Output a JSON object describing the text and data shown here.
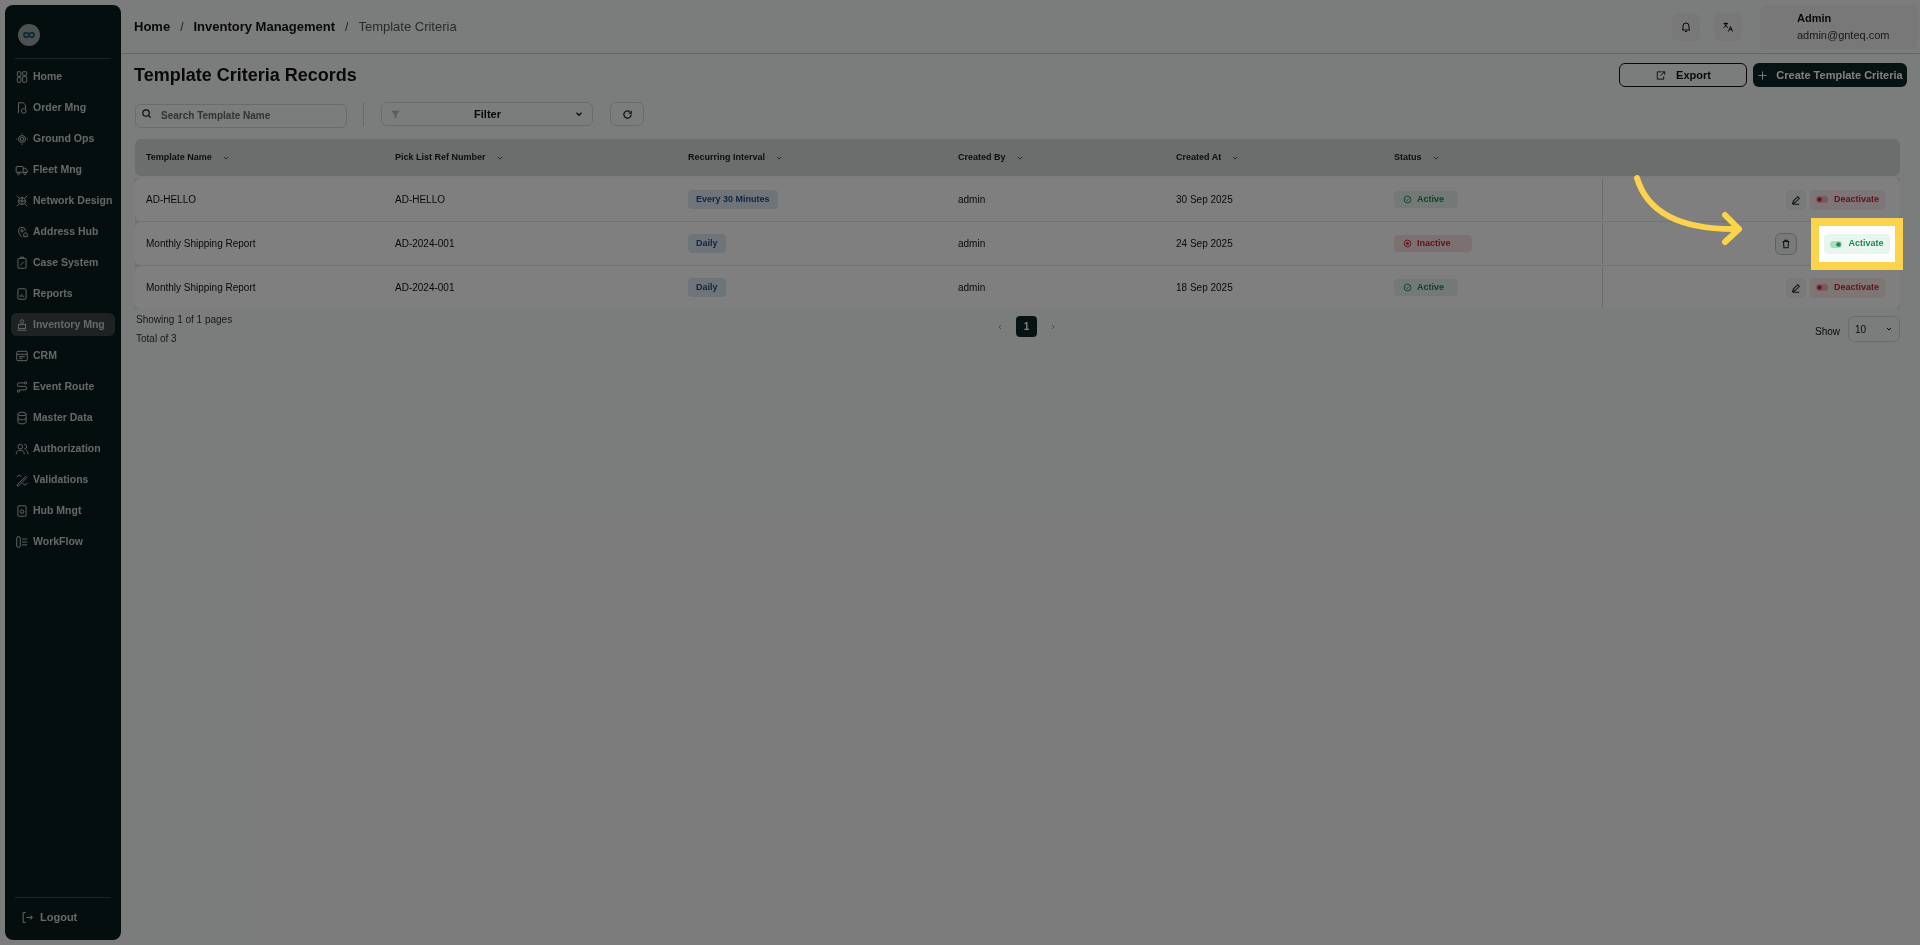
{
  "sidebar": {
    "items": [
      {
        "label": "Home",
        "selected": false
      },
      {
        "label": "Order Mng",
        "selected": false
      },
      {
        "label": "Ground Ops",
        "selected": false
      },
      {
        "label": "Fleet Mng",
        "selected": false
      },
      {
        "label": "Network Design",
        "selected": false
      },
      {
        "label": "Address Hub",
        "selected": false
      },
      {
        "label": "Case System",
        "selected": false
      },
      {
        "label": "Reports",
        "selected": false
      },
      {
        "label": "Inventory Mng",
        "selected": true
      },
      {
        "label": "CRM",
        "selected": false
      },
      {
        "label": "Event Route",
        "selected": false
      },
      {
        "label": "Master Data",
        "selected": false
      },
      {
        "label": "Authorization",
        "selected": false
      },
      {
        "label": "Validations",
        "selected": false
      },
      {
        "label": "Hub Mngt",
        "selected": false
      },
      {
        "label": "WorkFlow",
        "selected": false
      }
    ],
    "logout": "Logout"
  },
  "breadcrumb": [
    {
      "kind": "link",
      "text": "Home"
    },
    {
      "kind": "separator",
      "text": "/"
    },
    {
      "kind": "link",
      "text": "Inventory Management"
    },
    {
      "kind": "separator",
      "text": "/"
    },
    {
      "kind": "current",
      "text": "Template Criteria"
    }
  ],
  "user": {
    "name": "Admin",
    "email": "admin@gnteq.com"
  },
  "page_title": "Template Criteria Records",
  "search": {
    "placeholder": "Search Template Name"
  },
  "filter": {
    "label": "Filter"
  },
  "buttons": {
    "export": "Export",
    "create": "Create Template Criteria"
  },
  "table": {
    "columns": [
      "Template Name",
      "Pick List Ref Number",
      "Recurring Interval",
      "Created By",
      "Created At",
      "Status"
    ],
    "rows": [
      {
        "name": "AD-HELLO",
        "ref": "AD-HELLO",
        "interval": "Every 30 Minutes",
        "created_by": "admin",
        "created_at": "30 Sep 2025",
        "status": {
          "label": "Active",
          "active": true
        },
        "highlighted": false,
        "actions": [
          {
            "kind": "edit"
          },
          {
            "kind": "toggle",
            "label": "Deactivate",
            "on": true
          }
        ]
      },
      {
        "name": "Monthly Shipping Report",
        "ref": "AD-2024-001",
        "interval": "Daily",
        "created_by": "admin",
        "created_at": "24 Sep 2025",
        "status": {
          "label": "Inactive",
          "active": false
        },
        "highlighted": true,
        "actions": [
          {
            "kind": "delete"
          },
          {
            "kind": "toggle",
            "label": "Activate",
            "on": false
          }
        ]
      },
      {
        "name": "Monthly Shipping Report",
        "ref": "AD-2024-001",
        "interval": "Daily",
        "created_by": "admin",
        "created_at": "18 Sep 2025",
        "status": {
          "label": "Active",
          "active": true
        },
        "highlighted": false,
        "actions": [
          {
            "kind": "edit"
          },
          {
            "kind": "toggle",
            "label": "Deactivate",
            "on": true
          }
        ]
      }
    ]
  },
  "pagination": {
    "summary": "Showing 1 of 1 pages",
    "total": "Total of 3",
    "pages": [
      {
        "label": "1",
        "selected": true
      }
    ],
    "show_label": "Show",
    "page_size": "10"
  }
}
